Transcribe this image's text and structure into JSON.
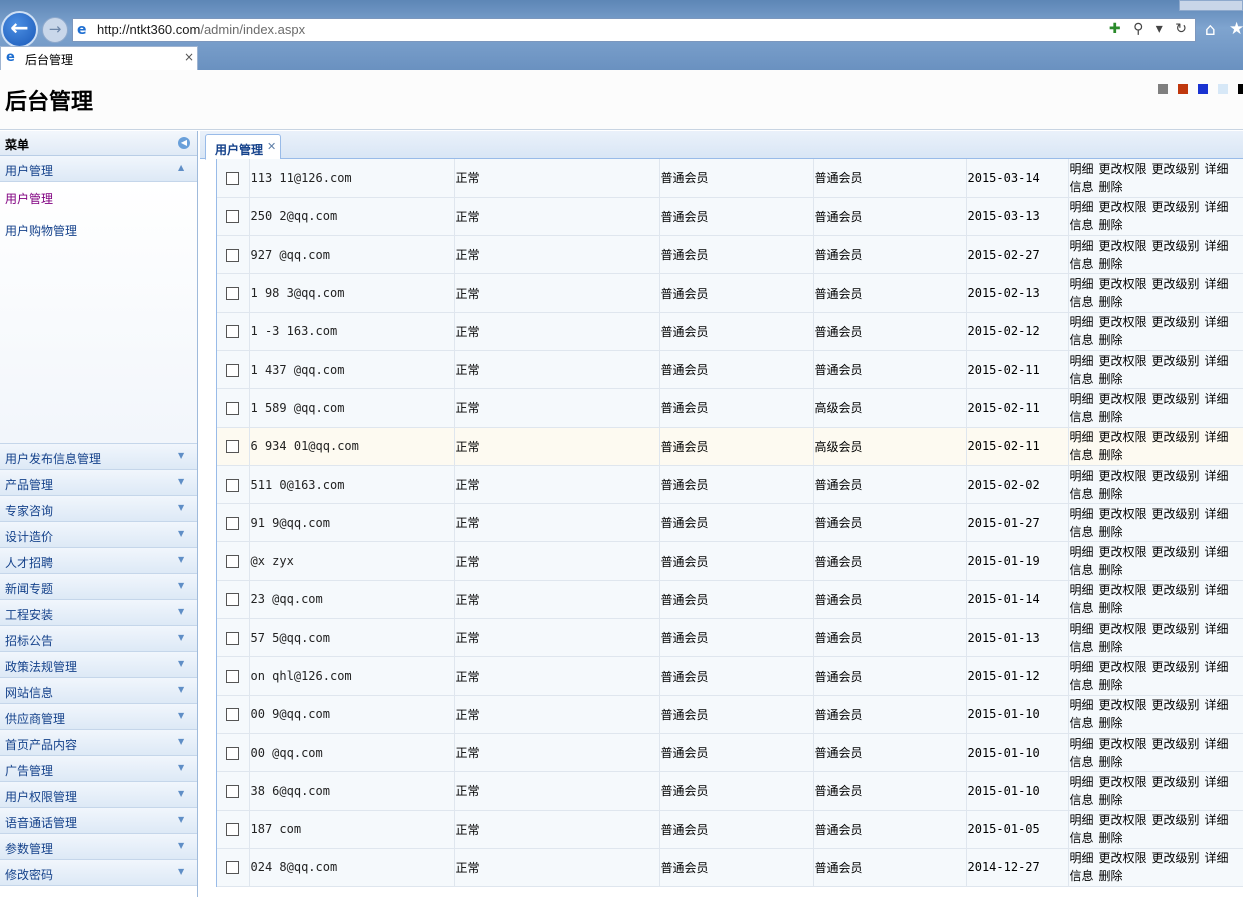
{
  "browser": {
    "url_host": "http://ntkt360.com",
    "url_path": "/admin/index.aspx",
    "tab_title": "后台管理"
  },
  "header": {
    "title": "后台管理",
    "theme_colors": [
      "#7f7f7f",
      "#c0380e",
      "#1a33d1",
      "#d7e8f7",
      "#000000"
    ]
  },
  "sidebar": {
    "menu_title": "菜单",
    "open_group": {
      "label": "用户管理",
      "items": [
        {
          "label": "用户管理",
          "active": true
        },
        {
          "label": "用户购物管理",
          "active": false
        }
      ]
    },
    "groups": [
      "用户发布信息管理",
      "产品管理",
      "专家咨询",
      "设计造价",
      "人才招聘",
      "新闻专题",
      "工程安装",
      "招标公告",
      "政策法规管理",
      "网站信息",
      "供应商管理",
      "首页产品内容",
      "广告管理",
      "用户权限管理",
      "语音通话管理",
      "参数管理",
      "修改密码"
    ]
  },
  "main": {
    "tab_label": "用户管理",
    "actions": [
      "明细",
      "更改权限",
      "更改级别",
      "详细",
      "信息",
      "删除"
    ],
    "rows": [
      {
        "email": "113 11@126.com",
        "status": "正常",
        "type": "普通会员",
        "level": "普通会员",
        "date": "2015-03-14",
        "highlight": false
      },
      {
        "email": "250 2@qq.com",
        "status": "正常",
        "type": "普通会员",
        "level": "普通会员",
        "date": "2015-03-13",
        "highlight": false
      },
      {
        "email": "927 @qq.com",
        "status": "正常",
        "type": "普通会员",
        "level": "普通会员",
        "date": "2015-02-27",
        "highlight": false
      },
      {
        "email": "1 98 3@qq.com",
        "status": "正常",
        "type": "普通会员",
        "level": "普通会员",
        "date": "2015-02-13",
        "highlight": false
      },
      {
        "email": "1 -3 163.com",
        "status": "正常",
        "type": "普通会员",
        "level": "普通会员",
        "date": "2015-02-12",
        "highlight": false
      },
      {
        "email": "1 437 @qq.com",
        "status": "正常",
        "type": "普通会员",
        "level": "普通会员",
        "date": "2015-02-11",
        "highlight": false
      },
      {
        "email": "1 589 @qq.com",
        "status": "正常",
        "type": "普通会员",
        "level": "高级会员",
        "date": "2015-02-11",
        "highlight": false
      },
      {
        "email": "6 934 01@qq.com",
        "status": "正常",
        "type": "普通会员",
        "level": "高级会员",
        "date": "2015-02-11",
        "highlight": true
      },
      {
        "email": "511 0@163.com",
        "status": "正常",
        "type": "普通会员",
        "level": "普通会员",
        "date": "2015-02-02",
        "highlight": false
      },
      {
        "email": "91 9@qq.com",
        "status": "正常",
        "type": "普通会员",
        "level": "普通会员",
        "date": "2015-01-27",
        "highlight": false
      },
      {
        "email": "@x zyx",
        "status": "正常",
        "type": "普通会员",
        "level": "普通会员",
        "date": "2015-01-19",
        "highlight": false
      },
      {
        "email": "23 @qq.com",
        "status": "正常",
        "type": "普通会员",
        "level": "普通会员",
        "date": "2015-01-14",
        "highlight": false
      },
      {
        "email": "57 5@qq.com",
        "status": "正常",
        "type": "普通会员",
        "level": "普通会员",
        "date": "2015-01-13",
        "highlight": false
      },
      {
        "email": "on qhl@126.com",
        "status": "正常",
        "type": "普通会员",
        "level": "普通会员",
        "date": "2015-01-12",
        "highlight": false
      },
      {
        "email": "00 9@qq.com",
        "status": "正常",
        "type": "普通会员",
        "level": "普通会员",
        "date": "2015-01-10",
        "highlight": false
      },
      {
        "email": "00 @qq.com",
        "status": "正常",
        "type": "普通会员",
        "level": "普通会员",
        "date": "2015-01-10",
        "highlight": false
      },
      {
        "email": "38 6@qq.com",
        "status": "正常",
        "type": "普通会员",
        "level": "普通会员",
        "date": "2015-01-10",
        "highlight": false
      },
      {
        "email": "187 com",
        "status": "正常",
        "type": "普通会员",
        "level": "普通会员",
        "date": "2015-01-05",
        "highlight": false
      },
      {
        "email": "024 8@qq.com",
        "status": "正常",
        "type": "普通会员",
        "level": "普通会员",
        "date": "2014-12-27",
        "highlight": false
      }
    ]
  }
}
